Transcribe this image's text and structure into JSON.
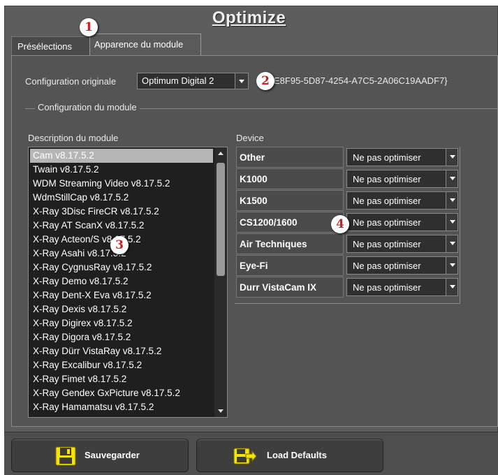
{
  "window": {
    "title": "Optimize"
  },
  "tabs": [
    {
      "label": "Présélections"
    },
    {
      "label": "Apparence du module"
    }
  ],
  "config": {
    "label": "Configuration originale",
    "selected": "Optimum Digital 2",
    "guid": "E8F95-5D87-4254-A7C5-2A06C19AADF7}"
  },
  "group": {
    "label": "Configuration du module"
  },
  "module_list": {
    "header": "Description du module",
    "items": [
      "Cam v8.17.5.2",
      "Twain v8.17.5.2",
      "WDM Streaming Video v8.17.5.2",
      "WdmStillCap v8.17.5.2",
      "X-Ray 3Disc FireCR v8.17.5.2",
      "X-Ray AT ScanX v8.17.5.2",
      "X-Ray Acteon/S v8.17.5.2",
      "X-Ray Asahi v8.17.5.2",
      "X-Ray CygnusRay v8.17.5.2",
      "X-Ray Demo v8.17.5.2",
      "X-Ray Dent-X Eva v8.17.5.2",
      "X-Ray Dexis v8.17.5.2",
      "X-Ray Digirex v8.17.5.2",
      "X-Ray Digora v8.17.5.2",
      "X-Ray Dürr VistaRay v8.17.5.2",
      "X-Ray Excalibur v8.17.5.2",
      "X-Ray Fimet v8.17.5.2",
      "X-Ray Gendex GxPicture v8.17.5.2",
      "X-Ray Hamamatsu v8.17.5.2"
    ],
    "selected_index": 0
  },
  "devices": {
    "header": "Device",
    "rows": [
      {
        "name": "Other",
        "value": "Ne pas optimiser"
      },
      {
        "name": "K1000",
        "value": "Ne pas optimiser"
      },
      {
        "name": "K1500",
        "value": "Ne pas optimiser"
      },
      {
        "name": "CS1200/1600",
        "value": "Ne pas optimiser"
      },
      {
        "name": "Air Techniques",
        "value": "Ne pas optimiser"
      },
      {
        "name": "Eye-Fi",
        "value": "Ne pas optimiser"
      },
      {
        "name": "Durr VistaCam IX",
        "value": "Ne pas optimiser"
      }
    ]
  },
  "callouts": [
    "1",
    "2",
    "3",
    "4"
  ],
  "buttons": {
    "save": {
      "label": "Sauvegarder",
      "icon": "floppy-icon"
    },
    "defaults": {
      "label": "Load Defaults",
      "icon": "load-defaults-icon"
    }
  },
  "colors": {
    "background": "#5d5d5d",
    "callout_text": "#cc1f1f",
    "icon_yellow": "#f5e400"
  }
}
